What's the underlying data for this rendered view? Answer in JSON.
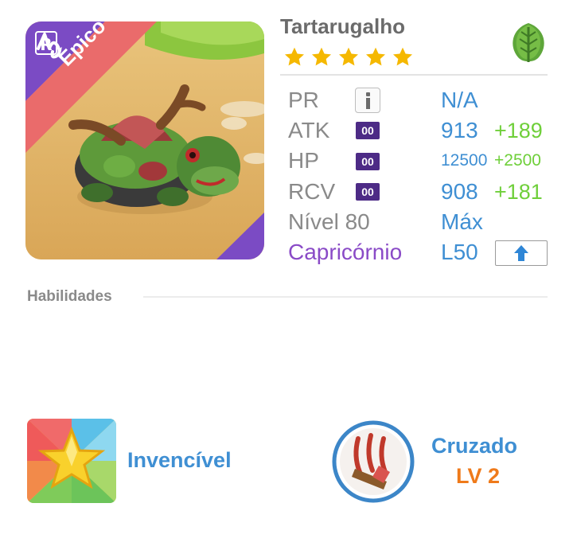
{
  "monster": {
    "name": "Tartarugalho",
    "rarity": "Épico",
    "rarity_badge": "R",
    "stars": 5,
    "element_icon": "leaf-icon",
    "zodiac_icon": "capricorn-icon"
  },
  "stats": {
    "pr_label": "PR",
    "pr_value": "N/A",
    "atk_label": "ATK",
    "atk_badge": "00",
    "atk_value": "913",
    "atk_bonus": "+189",
    "hp_label": "HP",
    "hp_badge": "00",
    "hp_value": "12500",
    "hp_bonus": "+2500",
    "rcv_label": "RCV",
    "rcv_badge": "00",
    "rcv_value": "908",
    "rcv_bonus": "+181",
    "level_label": "Nível 80",
    "level_value": "Máx",
    "constellation_label": "Capricórnio",
    "constellation_level": "L50"
  },
  "skills": {
    "section_title": "Habilidades",
    "active_name": "Invencível",
    "leader_name": "Cruzado",
    "leader_level": "LV 2"
  },
  "colors": {
    "accent_blue": "#3f8fd3",
    "bonus_green": "#6fcf3a",
    "rarity_red": "#ea6b6b",
    "rarity_purple": "#7b4bc4",
    "level_orange": "#ef7a1a"
  }
}
